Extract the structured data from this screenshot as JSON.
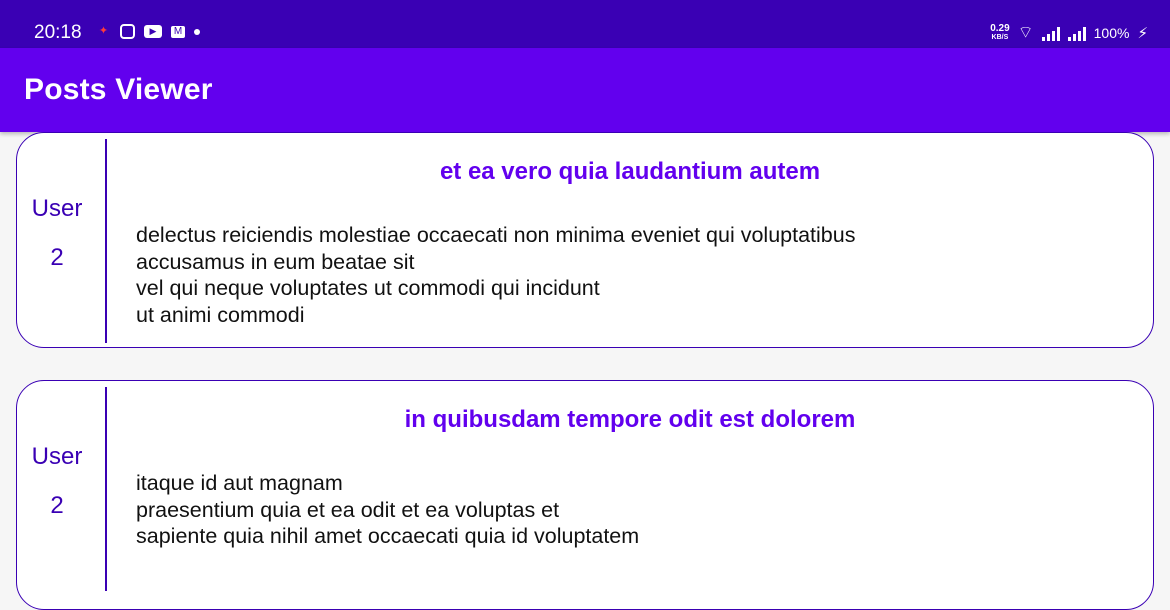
{
  "status_bar": {
    "time": "20:18",
    "notification_icons": [
      "app-notification-icon",
      "instagram-icon",
      "youtube-icon",
      "gmail-icon",
      "more-dot-icon"
    ],
    "net_speed_value": "0.29",
    "net_speed_unit": "KB/S",
    "battery": "100%"
  },
  "app_bar": {
    "title": "Posts Viewer",
    "color": "#6200ee"
  },
  "posts": [
    {
      "user_label": "User",
      "user_id": "2",
      "title": "et ea vero quia laudantium autem",
      "body_lines": [
        "delectus reiciendis molestiae occaecati non minima eveniet qui voluptatibus",
        "accusamus in eum beatae sit",
        "vel qui neque voluptates ut commodi qui incidunt",
        "ut animi commodi"
      ]
    },
    {
      "user_label": "User",
      "user_id": "2",
      "title": "in quibusdam tempore odit est dolorem",
      "body_lines": [
        "itaque id aut magnam",
        "praesentium quia et ea odit et ea voluptas et",
        "sapiente quia nihil amet occaecati quia id voluptatem"
      ]
    }
  ],
  "colors": {
    "status_bar": "#3a00b4",
    "accent": "#6200ee",
    "card_border": "#3a00b4",
    "background": "#f6f6f6"
  }
}
